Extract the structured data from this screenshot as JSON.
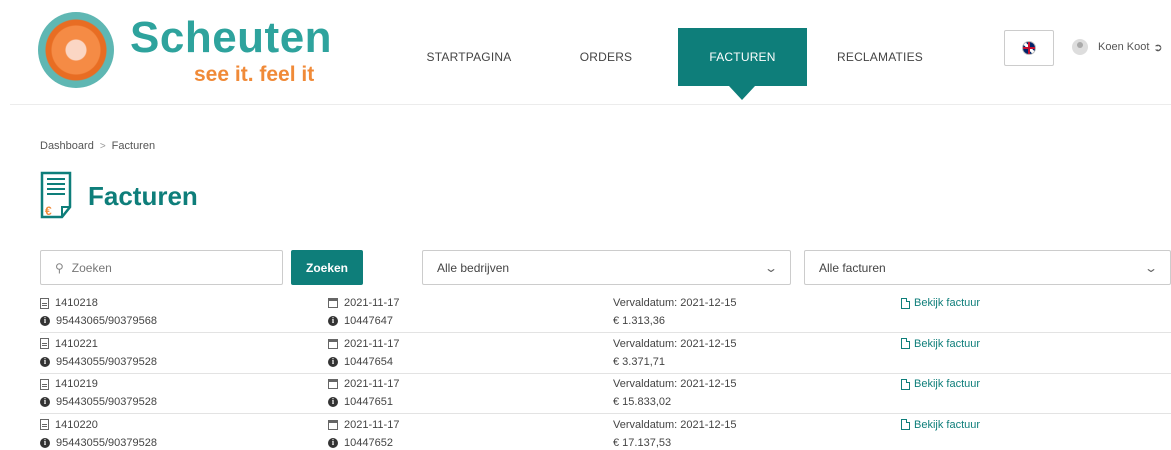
{
  "logo": {
    "name": "Scheuten",
    "tagline": "see it. feel it"
  },
  "nav": {
    "items": [
      {
        "label": "STARTPAGINA"
      },
      {
        "label": "ORDERS"
      },
      {
        "label": "FACTUREN"
      },
      {
        "label": "RECLAMATIES"
      }
    ],
    "active_index": 2
  },
  "user": {
    "name": "Koen Koot"
  },
  "breadcrumb": {
    "home": "Dashboard",
    "separator": ">",
    "current": "Facturen"
  },
  "page": {
    "title": "Facturen"
  },
  "filters": {
    "search_placeholder": "Zoeken",
    "search_button": "Zoeken",
    "company_select": "Alle bedrijven",
    "invoice_select": "Alle facturen"
  },
  "invoices": [
    {
      "number": "1410218",
      "reference": "95443065/90379568",
      "date": "2021-11-17",
      "order": "10447647",
      "due": "Vervaldatum: 2021-12-15",
      "amount": "€ 1.313,36",
      "link": "Bekijk factuur"
    },
    {
      "number": "1410221",
      "reference": "95443055/90379528",
      "date": "2021-11-17",
      "order": "10447654",
      "due": "Vervaldatum: 2021-12-15",
      "amount": "€ 3.371,71",
      "link": "Bekijk factuur"
    },
    {
      "number": "1410219",
      "reference": "95443055/90379528",
      "date": "2021-11-17",
      "order": "10447651",
      "due": "Vervaldatum: 2021-12-15",
      "amount": "€ 15.833,02",
      "link": "Bekijk factuur"
    },
    {
      "number": "1410220",
      "reference": "95443055/90379528",
      "date": "2021-11-17",
      "order": "10447652",
      "due": "Vervaldatum: 2021-12-15",
      "amount": "€ 17.137,53",
      "link": "Bekijk factuur"
    }
  ],
  "colors": {
    "brand_teal": "#0e7e7a",
    "logo_teal": "#2ea39d",
    "logo_orange": "#f08a38"
  },
  "icons": {
    "invoice_number": "document-icon",
    "reference": "info-icon",
    "date": "calendar-icon",
    "view": "pdf-icon",
    "search": "search-icon",
    "dropdown": "chevron-down-icon",
    "language": "uk-flag-icon",
    "logout": "logout-icon"
  }
}
